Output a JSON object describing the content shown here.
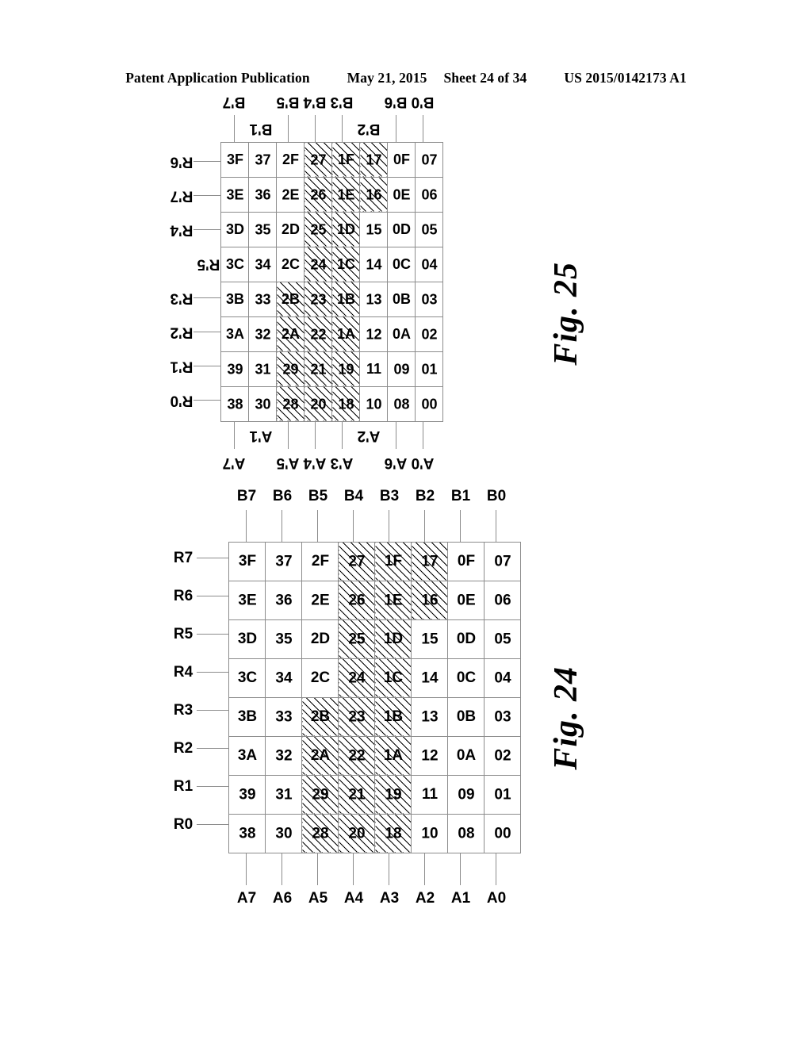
{
  "header": {
    "publication": "Patent Application Publication",
    "date": "May 21, 2015",
    "sheet": "Sheet 24 of 34",
    "pubnumber": "US 2015/0142173 A1"
  },
  "figures": [
    {
      "id": "fig25",
      "caption": "Fig. 25",
      "label_orientation": "inverted",
      "column_labels": [
        "R'0",
        "R'1",
        "R'2",
        "R'3",
        "R'5",
        "R'4",
        "R'7",
        "R'6"
      ],
      "left_labels": [
        "A'7",
        "A'1",
        "A'5",
        "A'4",
        "A'3",
        "A'2",
        "A'6",
        "A'0"
      ],
      "right_labels": [
        "B'7",
        "B'1",
        "B'5",
        "B'4",
        "B'3",
        "B'2",
        "B'6",
        "B'0"
      ],
      "rows": [
        [
          "38",
          "39",
          "3A",
          "3B",
          "3C",
          "3D",
          "3E",
          "3F"
        ],
        [
          "30",
          "31",
          "32",
          "33",
          "34",
          "35",
          "36",
          "37"
        ],
        [
          "28",
          "29",
          "2A",
          "2B",
          "2C",
          "2D",
          "2E",
          "2F"
        ],
        [
          "20",
          "21",
          "22",
          "23",
          "24",
          "25",
          "26",
          "27"
        ],
        [
          "18",
          "19",
          "1A",
          "1B",
          "1C",
          "1D",
          "1E",
          "1F"
        ],
        [
          "10",
          "11",
          "12",
          "13",
          "14",
          "15",
          "16",
          "17"
        ],
        [
          "08",
          "09",
          "0A",
          "0B",
          "0C",
          "0D",
          "0E",
          "0F"
        ],
        [
          "00",
          "01",
          "02",
          "03",
          "04",
          "05",
          "06",
          "07"
        ]
      ],
      "hatched": [
        [
          false,
          false,
          false,
          false,
          false,
          false,
          false,
          false
        ],
        [
          false,
          false,
          false,
          false,
          false,
          false,
          false,
          false
        ],
        [
          true,
          true,
          true,
          true,
          false,
          false,
          false,
          false
        ],
        [
          true,
          true,
          true,
          true,
          true,
          true,
          true,
          true
        ],
        [
          true,
          true,
          true,
          true,
          true,
          true,
          true,
          true
        ],
        [
          false,
          false,
          false,
          false,
          false,
          false,
          true,
          true
        ],
        [
          false,
          false,
          false,
          false,
          false,
          false,
          false,
          false
        ],
        [
          false,
          false,
          false,
          false,
          false,
          false,
          false,
          false
        ]
      ],
      "leader_left": [
        true,
        false,
        true,
        true,
        true,
        false,
        true,
        true
      ],
      "leader_right": [
        true,
        false,
        true,
        true,
        true,
        false,
        true,
        true
      ],
      "leader_top": [
        true,
        true,
        true,
        true,
        false,
        true,
        true,
        true
      ]
    },
    {
      "id": "fig24",
      "caption": "Fig. 24",
      "label_orientation": "upright",
      "column_labels": [
        "R0",
        "R1",
        "R2",
        "R3",
        "R4",
        "R5",
        "R6",
        "R7"
      ],
      "left_labels": [
        "A7",
        "A6",
        "A5",
        "A4",
        "A3",
        "A2",
        "A1",
        "A0"
      ],
      "right_labels": [
        "B7",
        "B6",
        "B5",
        "B4",
        "B3",
        "B2",
        "B1",
        "B0"
      ],
      "rows": [
        [
          "38",
          "39",
          "3A",
          "3B",
          "3C",
          "3D",
          "3E",
          "3F"
        ],
        [
          "30",
          "31",
          "32",
          "33",
          "34",
          "35",
          "36",
          "37"
        ],
        [
          "28",
          "29",
          "2A",
          "2B",
          "2C",
          "2D",
          "2E",
          "2F"
        ],
        [
          "20",
          "21",
          "22",
          "23",
          "24",
          "25",
          "26",
          "27"
        ],
        [
          "18",
          "19",
          "1A",
          "1B",
          "1C",
          "1D",
          "1E",
          "1F"
        ],
        [
          "10",
          "11",
          "12",
          "13",
          "14",
          "15",
          "16",
          "17"
        ],
        [
          "08",
          "09",
          "0A",
          "0B",
          "0C",
          "0D",
          "0E",
          "0F"
        ],
        [
          "00",
          "01",
          "02",
          "03",
          "04",
          "05",
          "06",
          "07"
        ]
      ],
      "hatched": [
        [
          false,
          false,
          false,
          false,
          false,
          false,
          false,
          false
        ],
        [
          false,
          false,
          false,
          false,
          false,
          false,
          false,
          false
        ],
        [
          true,
          true,
          true,
          true,
          false,
          false,
          false,
          false
        ],
        [
          true,
          true,
          true,
          true,
          true,
          true,
          true,
          true
        ],
        [
          true,
          true,
          true,
          true,
          true,
          true,
          true,
          true
        ],
        [
          false,
          false,
          false,
          false,
          false,
          false,
          true,
          true
        ],
        [
          false,
          false,
          false,
          false,
          false,
          false,
          false,
          false
        ],
        [
          false,
          false,
          false,
          false,
          false,
          false,
          false,
          false
        ]
      ],
      "leader_left": [
        true,
        true,
        true,
        true,
        true,
        true,
        true,
        true
      ],
      "leader_right": [
        true,
        true,
        true,
        true,
        true,
        true,
        true,
        true
      ],
      "leader_top": [
        true,
        true,
        true,
        true,
        true,
        true,
        true,
        true
      ]
    }
  ]
}
